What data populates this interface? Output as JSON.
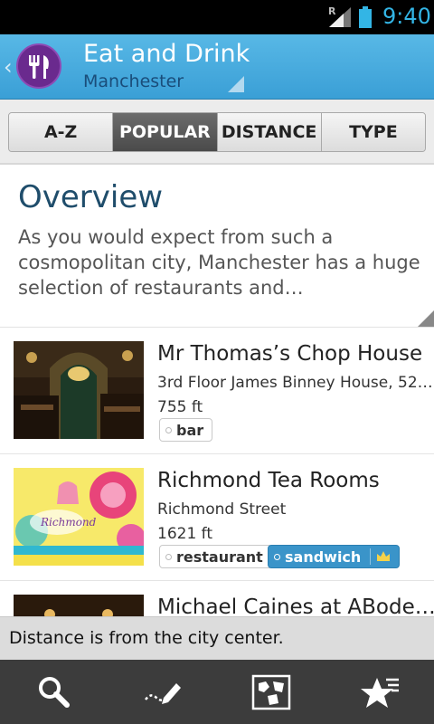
{
  "status_bar": {
    "time": "9:40",
    "roaming": "R"
  },
  "action_bar": {
    "title": "Eat and Drink",
    "subtitle": "Manchester"
  },
  "tabs": [
    {
      "label": "A-Z"
    },
    {
      "label": "POPULAR",
      "active": true
    },
    {
      "label": "DISTANCE"
    },
    {
      "label": "TYPE"
    }
  ],
  "overview": {
    "title": "Overview",
    "text": "As you would expect from such a cosmopolitan city, Manchester has a huge selection of restaurants and…"
  },
  "list": [
    {
      "name": "Mr Thomas’s Chop House",
      "address": "3rd Floor James Binney House, 52…",
      "distance": "755 ft",
      "tags": [
        "bar"
      ]
    },
    {
      "name": "Richmond Tea Rooms",
      "address": "Richmond Street",
      "distance": "1621 ft",
      "tags": [
        "restaurant",
        "sandwich"
      ]
    },
    {
      "name": "Michael Caines at ABode…"
    }
  ],
  "toast": "Distance is from the city center.",
  "bottom_nav": [
    "search-icon",
    "edit-icon",
    "map-icon",
    "favorites-icon"
  ],
  "colors": {
    "accent": "#33b5e5",
    "action_bar": "#4aaadd",
    "title_blue": "#1f4d6b",
    "tag_highlight": "#3a94c9"
  }
}
